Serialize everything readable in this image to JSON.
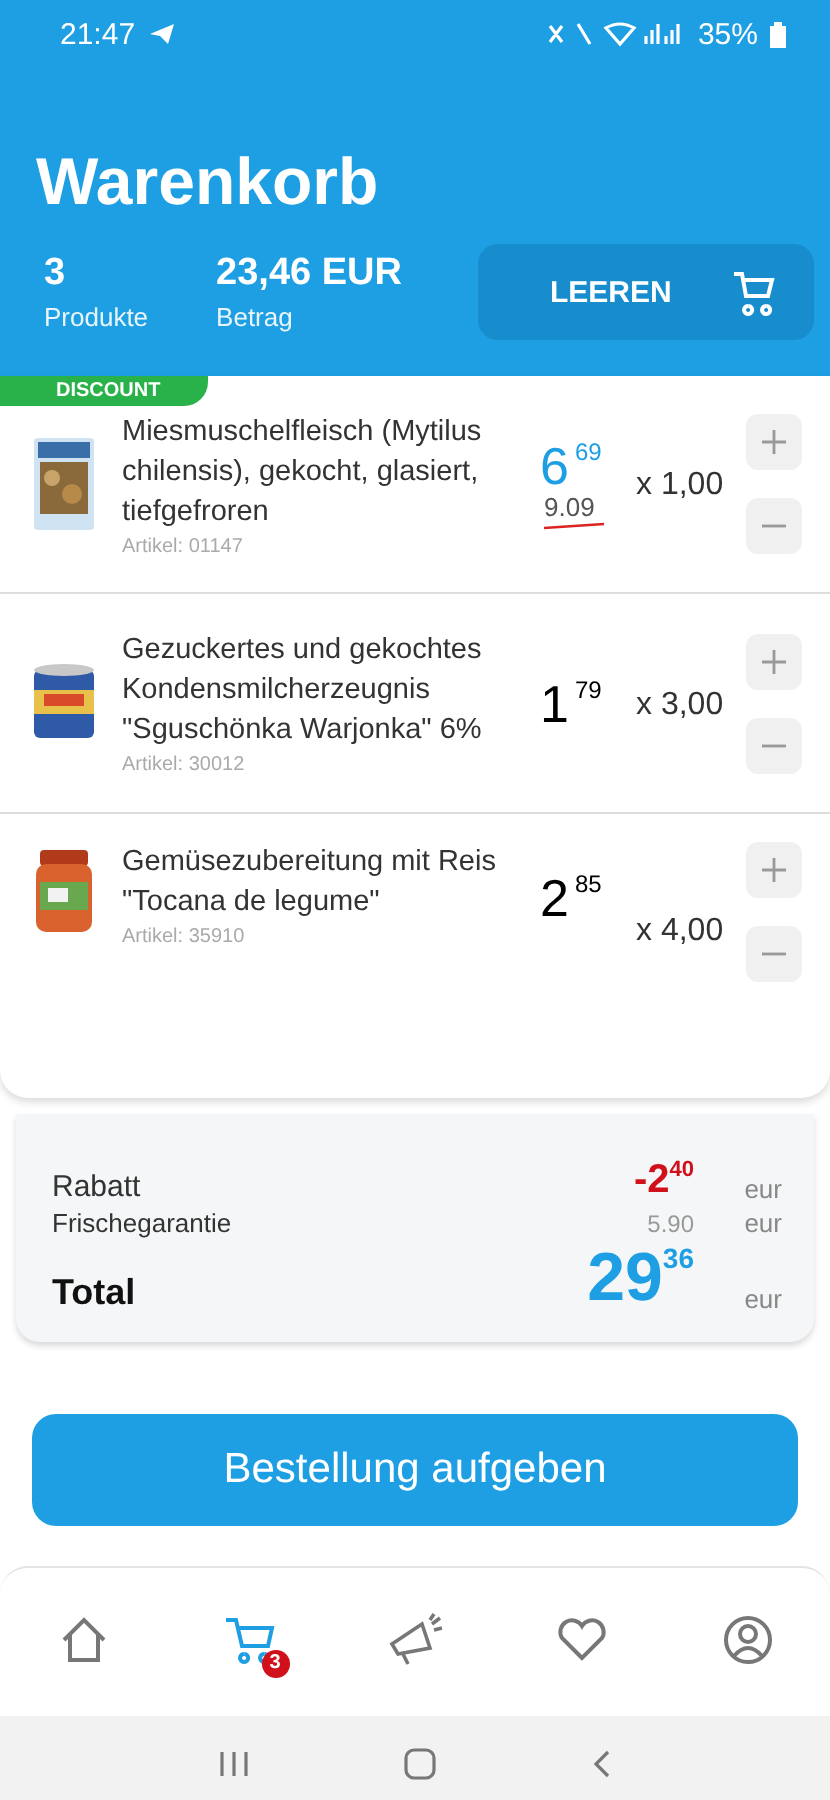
{
  "status_bar": {
    "time": "21:47",
    "battery": "35%"
  },
  "header": {
    "title": "Warenkorb",
    "stats": [
      {
        "value": "3",
        "label": "Produkte"
      },
      {
        "value": "23,46 EUR",
        "label": "Betrag"
      }
    ],
    "clear_button": "LEEREN"
  },
  "items": [
    {
      "badge": "DISCOUNT",
      "name": "Miesmuschelfleisch (Mytilus chilensis), gekocht, glasiert, tiefgefroren",
      "article": "Artikel: 01147",
      "price_main": "6",
      "price_cents": "69",
      "old_price": "9.09",
      "quantity": "x 1,00",
      "discounted": true
    },
    {
      "name": "Gezuckertes und gekochtes Kondensmilcherzeugnis \"Sguschönka Warjonka\" 6%",
      "article": "Artikel: 30012",
      "price_main": "1",
      "price_cents": "79",
      "quantity": "x 3,00",
      "discounted": false
    },
    {
      "name": "Gemüsezubereitung mit Reis \"Tocana de legume\"",
      "article": "Artikel: 35910",
      "price_main": "2",
      "price_cents": "85",
      "quantity": "x 4,00",
      "discounted": false
    }
  ],
  "summary": {
    "rows": [
      {
        "kind": "discount",
        "label": "Rabatt",
        "main": "-2",
        "cents": "40",
        "unit": "eur"
      },
      {
        "kind": "fee",
        "label": "Frischegarantie",
        "value": "5.90",
        "unit": "eur"
      },
      {
        "kind": "total",
        "label": "Total",
        "main": "29",
        "cents": "36",
        "unit": "eur"
      }
    ]
  },
  "order_button": "Bestellung aufgeben",
  "bottom_nav": [
    {
      "selected": false
    },
    {
      "selected": true,
      "badge": "3"
    },
    {
      "selected": false
    },
    {
      "selected": false
    },
    {
      "selected": false
    }
  ]
}
